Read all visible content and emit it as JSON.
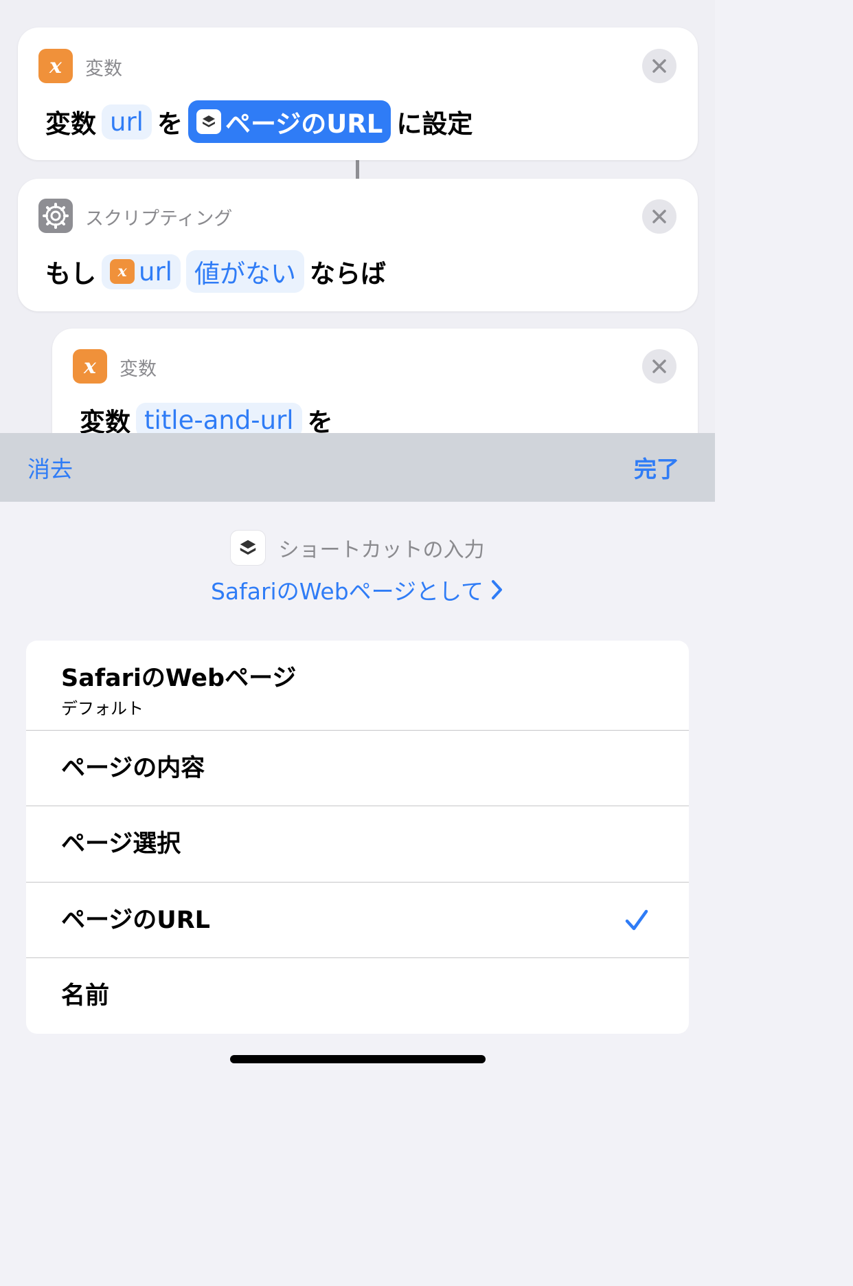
{
  "colors": {
    "accent": "#2f7cf6",
    "variable_icon": "#f0913a",
    "scripting_icon": "#8e8e93"
  },
  "actions": [
    {
      "category": "変数",
      "icon": "variable-x-icon",
      "prefix": "変数",
      "variable": "url",
      "middle": "を",
      "value": "ページのURL",
      "suffix": "に設定"
    },
    {
      "category": "スクリプティング",
      "icon": "gear-icon",
      "prefix": "もし",
      "variable": "url",
      "condition": "値がない",
      "suffix": "ならば"
    },
    {
      "category": "変数",
      "icon": "variable-x-icon",
      "prefix": "変数",
      "variable": "title-and-url",
      "middle": "を"
    }
  ],
  "toolbar": {
    "clear_label": "消去",
    "done_label": "完了"
  },
  "sheet": {
    "input_title": "ショートカットの入力",
    "input_type": "SafariのWebページとして",
    "options": [
      {
        "label": "SafariのWebページ",
        "subtitle": "デフォルト",
        "selected": false
      },
      {
        "label": "ページの内容",
        "selected": false
      },
      {
        "label": "ページ選択",
        "selected": false
      },
      {
        "label": "ページのURL",
        "selected": true
      },
      {
        "label": "名前",
        "selected": false
      }
    ]
  }
}
